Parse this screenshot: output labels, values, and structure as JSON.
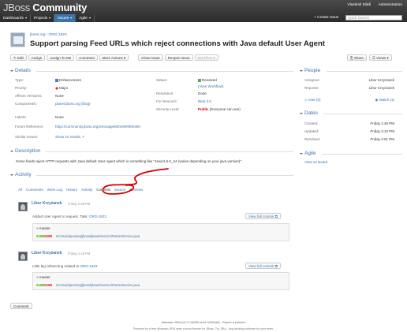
{
  "header": {
    "logo_prefix": "JBoss",
    "logo_main": "Community",
    "nav": [
      {
        "label": "Dashboards"
      },
      {
        "label": "Projects"
      },
      {
        "label": "Issues"
      },
      {
        "label": "Agile"
      }
    ],
    "user": "Vlastimil Eliáš",
    "admin": "Administration",
    "create": "+ Create Issue",
    "quick_search_placeholder": "Quick Search"
  },
  "issue": {
    "breadcrumb_project": "jboss.org",
    "breadcrumb_sep": "/",
    "breadcrumb_key": "ORG-1823",
    "title": "Support parsing Feed URLs which reject connections with Java default User Agent"
  },
  "toolbar": {
    "edit": "✎ Edit",
    "assign": "Assign",
    "assign_me": "Assign To Me",
    "comment": "Comment",
    "more": "More Actions ▾",
    "close": "Close Issue",
    "reopen": "Reopen Issue",
    "workflow": "Workflow ▾",
    "share": "Share",
    "views": "Views ▾"
  },
  "details": {
    "heading": "Details",
    "type_label": "Type:",
    "type": "Enhancement",
    "priority_label": "Priority:",
    "priority": "Major",
    "affects_label": "Affects Version/s:",
    "affects": "None",
    "components_label": "Component/s:",
    "components": "planet.jboss.org (blog)",
    "labels_label": "Labels:",
    "labels": "None",
    "forum_label": "Forum Reference:",
    "forum": "https://community.jboss.org/message/800490#800490",
    "similar_label": "Similar Issues:",
    "similar": "Show 10 results ↗",
    "status_label": "Status:",
    "status": "Resolved",
    "workflow_link": "(View Workflow)",
    "resolution_label": "Resolution:",
    "resolution": "Done",
    "fix_label": "Fix Version/s:",
    "fix": "Beta 3.0",
    "security_label": "Security Level:",
    "security_bold": "Public",
    "security_rest": " (Everyone can see)"
  },
  "people": {
    "heading": "People",
    "assignee_label": "Assignee:",
    "assignee": "Libor Krzyżanek",
    "reporter_label": "Reporter:",
    "reporter": "Libor Krzyżanek",
    "vote_label": "Vote (0)",
    "watch_label": "Watch (1)"
  },
  "dates": {
    "heading": "Dates",
    "created_label": "Created:",
    "created": "Friday 1:48 PM",
    "updated_label": "Updated:",
    "updated": "Friday 2:10 PM",
    "resolved_label": "Resolved:",
    "resolved": "Friday 2:01 PM"
  },
  "agile": {
    "heading": "Agile",
    "board": "View on Board"
  },
  "description": {
    "heading": "Description",
    "text": "Some feeds reject HTTP requests with Java default User Agent which is something like \"Java/1.6.0_24 (varies depending on your java version)\"."
  },
  "activity": {
    "heading": "Activity",
    "tabs": [
      {
        "label": "All"
      },
      {
        "label": "Comments"
      },
      {
        "label": "Work Log"
      },
      {
        "label": "History"
      },
      {
        "label": "Activity"
      },
      {
        "label": "Commits"
      },
      {
        "label": "Source"
      },
      {
        "label": "Reviews"
      }
    ],
    "commits": [
      {
        "author": "Libor Krzyżanek",
        "time": "Friday 2:08 PM",
        "view": "View full commit",
        "message": "Added User Agent to request. Task:",
        "message_link": "ORG-1823",
        "branch": "master",
        "added": "+16",
        "removed": "-2",
        "file": "src/main/java/org/jboss/planet/service/ParserService.java"
      },
      {
        "author": "Libor Krzyżanek",
        "time": "Friday 2:18 PM",
        "view": "View full commit",
        "message": "Little big refactoring related to",
        "message_link": "ORG-1823",
        "branch": "master",
        "added": "+18",
        "removed": "-11",
        "file": "src/main/java/org/jboss/planet/service/ParserService.java"
      }
    ],
    "comment_button": "Comment"
  },
  "footer": {
    "line1": "Atlassian JIRA (v6.2.7#6265-sha1:91604a8) · Report a problem",
    "line2": "Powered by a free Atlassian JIRA open source license for JBoss. Try JIRA - bug tracking software for your team."
  },
  "colors": {
    "link": "#3b73af",
    "header": "#333333",
    "annotation": "#d80000"
  }
}
